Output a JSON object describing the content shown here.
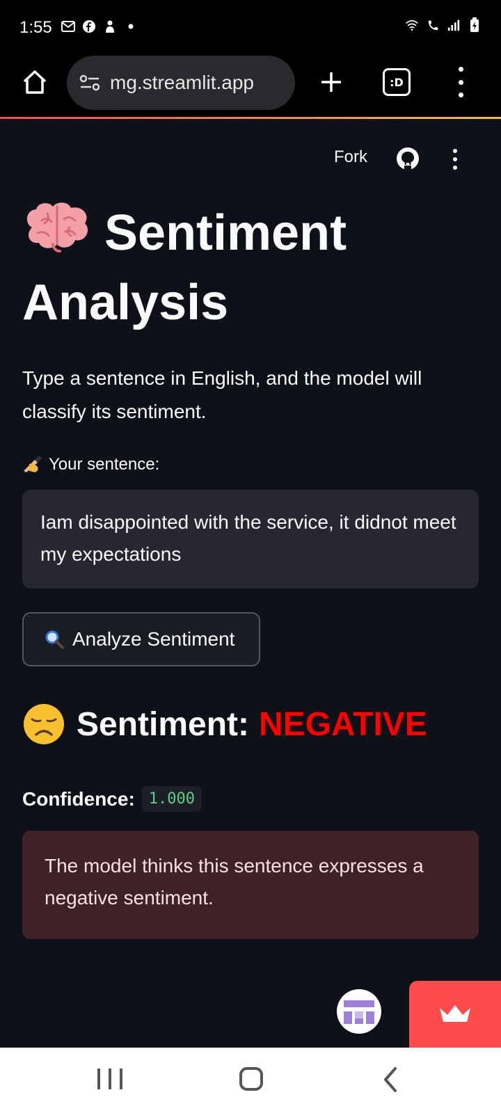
{
  "status_bar": {
    "time": "1:55"
  },
  "browser": {
    "url_prefix": "",
    "url": "mg.streamlit.app",
    "tab_count_label": ":D"
  },
  "app_header": {
    "fork_label": "Fork"
  },
  "main": {
    "title": "Sentiment Analysis",
    "subtitle": "Type a sentence in English, and the model will classify its sentiment.",
    "input_label": "Your sentence:",
    "input_value": "Iam disappointed with the service,  it didnot meet my expectations",
    "analyze_button_label": "Analyze Sentiment",
    "result_prefix": "Sentiment:",
    "result_value": "NEGATIVE",
    "confidence_label": "Confidence:",
    "confidence_value": "1.000",
    "explanation": "The model thinks this sentence expresses a negative sentiment."
  },
  "colors": {
    "background": "#0e1117",
    "negative": "#ff0000",
    "error_box_bg": "#3e2228",
    "confidence_text": "#5ecf86",
    "streamlit_red": "#ff4b4b"
  },
  "icons": {
    "title": "brain-icon",
    "input_label": "writing-hand-icon",
    "analyze_button": "magnifying-glass-icon",
    "result": "disappointed-face-icon"
  }
}
